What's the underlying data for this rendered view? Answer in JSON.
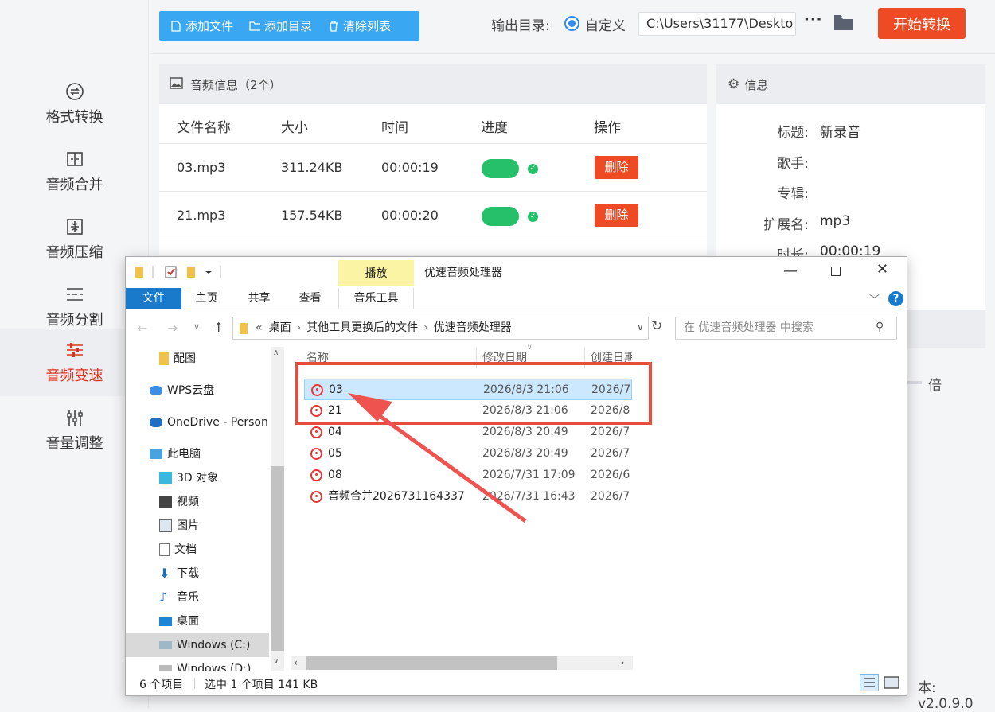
{
  "sidebar": {
    "items": [
      {
        "label": "格式转换",
        "icon": "format-convert-icon"
      },
      {
        "label": "音频合并",
        "icon": "merge-icon"
      },
      {
        "label": "音频压缩",
        "icon": "compress-icon"
      },
      {
        "label": "音频分割",
        "icon": "split-icon"
      },
      {
        "label": "音频变速",
        "icon": "speed-icon",
        "active": true
      },
      {
        "label": "音量调整",
        "icon": "volume-sliders-icon"
      }
    ]
  },
  "toolbar": {
    "add_file": "添加文件",
    "add_dir": "添加目录",
    "clear_list": "清除列表",
    "output_label": "输出目录:",
    "custom_label": "自定义",
    "output_path": "C:\\Users\\31177\\Deskto",
    "more": "···",
    "start": "开始转换"
  },
  "list": {
    "header": "音频信息（2个）",
    "columns": [
      "文件名称",
      "大小",
      "时间",
      "进度",
      "操作"
    ],
    "rows": [
      {
        "name": "03.mp3",
        "size": "311.24KB",
        "time": "00:00:19",
        "progress": 1.0,
        "action": "删除"
      },
      {
        "name": "21.mp3",
        "size": "157.54KB",
        "time": "00:00:20",
        "progress": 1.0,
        "action": "删除"
      }
    ]
  },
  "info": {
    "header": "信息",
    "fields": [
      {
        "k": "标题:",
        "v": "新录音"
      },
      {
        "k": "歌手:",
        "v": ""
      },
      {
        "k": "专辑:",
        "v": ""
      },
      {
        "k": "扩展名:",
        "v": "mp3"
      },
      {
        "k": "时长:",
        "v": "00:00:19"
      }
    ],
    "speed_unit": "倍",
    "version": "v2.0.9.0",
    "version_prefix": "本:"
  },
  "explorer": {
    "title": "优速音频处理器",
    "context_tab": "播放",
    "ribbon_tabs": [
      "文件",
      "主页",
      "共享",
      "查看",
      "音乐工具"
    ],
    "breadcrumb": [
      "«",
      "桌面",
      "其他工具更换后的文件",
      "优速音频处理器"
    ],
    "search_placeholder": "在 优速音频处理器 中搜索",
    "nav": [
      "配图",
      "WPS云盘",
      "OneDrive - Person",
      "此电脑",
      "3D 对象",
      "视频",
      "图片",
      "文档",
      "下载",
      "音乐",
      "桌面",
      "Windows (C:)",
      "Windows (D:)"
    ],
    "columns": [
      "名称",
      "修改日期",
      "创建日期"
    ],
    "files": [
      {
        "name": "03",
        "modified": "2026/8/3 21:06",
        "created": "2026/7",
        "selected": true
      },
      {
        "name": "21",
        "modified": "2026/8/3 21:06",
        "created": "2026/8"
      },
      {
        "name": "04",
        "modified": "2026/8/3 20:49",
        "created": "2026/7"
      },
      {
        "name": "05",
        "modified": "2026/8/3 20:49",
        "created": "2026/7"
      },
      {
        "name": "08",
        "modified": "2026/7/31 17:09",
        "created": "2026/6"
      },
      {
        "name": "音频合并2026731164337",
        "modified": "2026/7/31 16:43",
        "created": "2026/7"
      }
    ],
    "status_count": "6 个项目",
    "status_selected": "选中 1 个项目  141 KB"
  },
  "colors": {
    "accent": "#3aa7f3",
    "danger": "#ee4a24",
    "progress": "#27c06a",
    "highlight": "#e74c3c"
  }
}
